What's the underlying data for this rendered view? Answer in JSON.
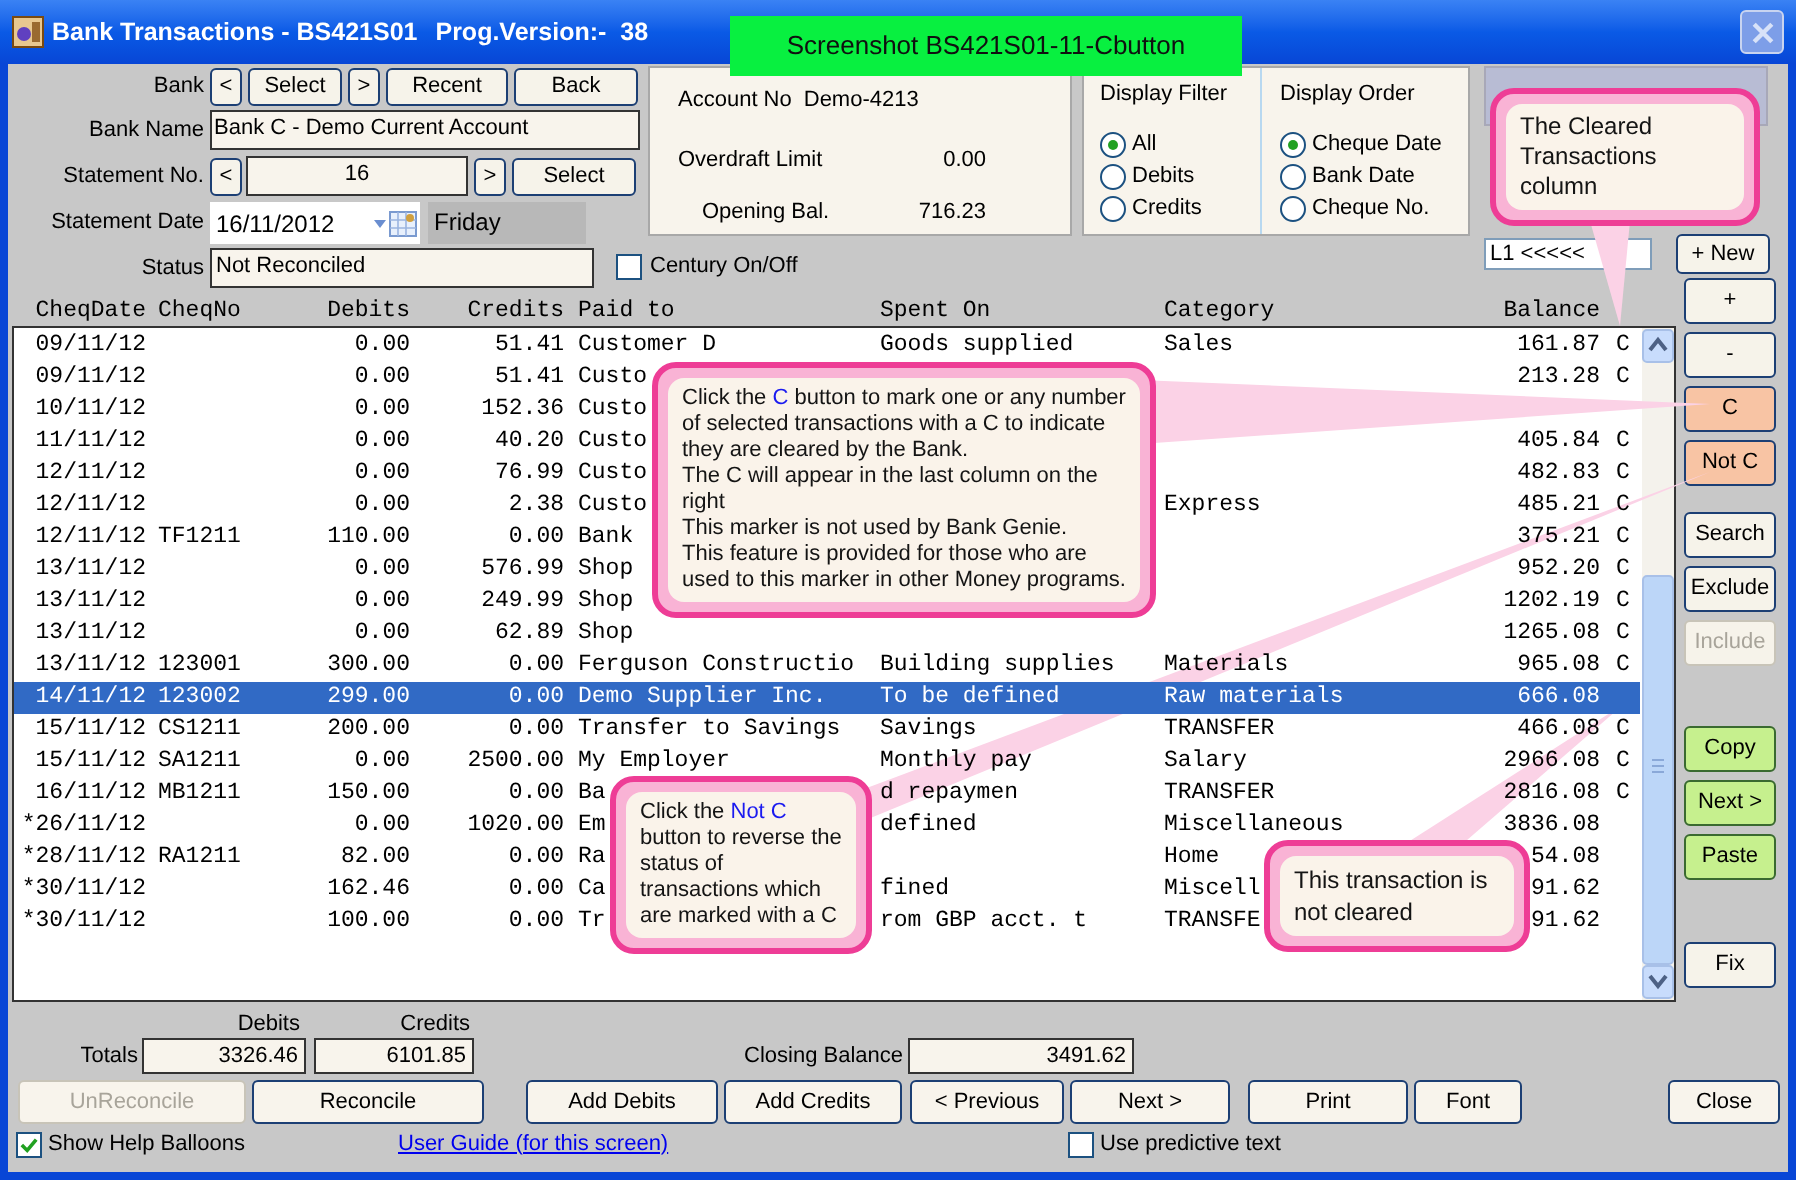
{
  "window": {
    "title": "Bank Transactions - BS421S01",
    "version": "Prog.Version:-  38"
  },
  "banner": "Screenshot BS421S01-11-Cbutton",
  "form": {
    "bank_label": "Bank",
    "bank_buttons": [
      "<",
      "Select",
      ">",
      "Recent",
      "Back"
    ],
    "bank_name_label": "Bank Name",
    "bank_name": "Bank C - Demo Current Account",
    "statement_no_label": "Statement No.",
    "statement_prev": "<",
    "statement_no": "16",
    "statement_next": ">",
    "statement_select": "Select",
    "statement_date_label": "Statement Date",
    "statement_date": "16/11/2012",
    "weekday": "Friday",
    "status_label": "Status",
    "status": "Not Reconciled",
    "century": {
      "label": "Century On/Off",
      "checked": false
    }
  },
  "account": {
    "account_no_label": "Account No",
    "account_no": "Demo-4213",
    "overdraft_label": "Overdraft Limit",
    "overdraft": "0.00",
    "opening_label": "Opening Bal.",
    "opening": "716.23"
  },
  "display_filter": {
    "title": "Display Filter",
    "options": [
      {
        "label": "All",
        "selected": true
      },
      {
        "label": "Debits",
        "selected": false
      },
      {
        "label": "Credits",
        "selected": false
      }
    ]
  },
  "display_order": {
    "title": "Display Order",
    "options": [
      {
        "label": "Cheque Date",
        "selected": true
      },
      {
        "label": "Bank Date",
        "selected": false
      },
      {
        "label": "Cheque No.",
        "selected": false
      }
    ]
  },
  "find_field": "L1 <<<<<",
  "new_button": "+ New",
  "table": {
    "columns": [
      "CheqDate",
      "CheqNo",
      "Debits",
      "Credits",
      "Paid to",
      "Spent On",
      "Category",
      "Balance"
    ],
    "rows": [
      {
        "date": "09/11/12",
        "debit": "0.00",
        "credit": "51.41",
        "paid_to": "Customer D",
        "spent_on": "Goods supplied",
        "category": "Sales",
        "balance": "161.87",
        "mark": "C",
        "selected": false
      },
      {
        "date": "09/11/12",
        "debit": "0.00",
        "credit": "51.41",
        "paid_to": "Custo",
        "balance": "213.28",
        "mark": "C",
        "selected": false
      },
      {
        "date": "10/11/12",
        "debit": "0.00",
        "credit": "152.36",
        "paid_to": "Custo",
        "selected": false
      },
      {
        "date": "11/11/12",
        "debit": "0.00",
        "credit": "40.20",
        "paid_to": "Custo",
        "balance": "405.84",
        "mark": "C",
        "selected": false
      },
      {
        "date": "12/11/12",
        "debit": "0.00",
        "credit": "76.99",
        "paid_to": "Custo",
        "balance": "482.83",
        "mark": "C",
        "selected": false
      },
      {
        "date": "12/11/12",
        "debit": "0.00",
        "credit": "2.38",
        "paid_to": "Custo",
        "category": "Express",
        "balance": "485.21",
        "mark": "C",
        "selected": false
      },
      {
        "date": "12/11/12",
        "cheque": "TF1211",
        "debit": "110.00",
        "credit": "0.00",
        "paid_to": "Bank",
        "balance": "375.21",
        "mark": "C",
        "selected": false
      },
      {
        "date": "13/11/12",
        "debit": "0.00",
        "credit": "576.99",
        "paid_to": "Shop",
        "balance": "952.20",
        "mark": "C",
        "selected": false
      },
      {
        "date": "13/11/12",
        "debit": "0.00",
        "credit": "249.99",
        "paid_to": "Shop",
        "balance": "1202.19",
        "mark": "C",
        "selected": false
      },
      {
        "date": "13/11/12",
        "debit": "0.00",
        "credit": "62.89",
        "paid_to": "Shop",
        "balance": "1265.08",
        "mark": "C",
        "selected": false
      },
      {
        "date": "13/11/12",
        "cheque": "123001",
        "debit": "300.00",
        "credit": "0.00",
        "paid_to": "Ferguson Constructio",
        "spent_on": "Building supplies",
        "category": "Materials",
        "balance": "965.08",
        "mark": "C",
        "selected": false
      },
      {
        "date": "14/11/12",
        "cheque": "123002",
        "debit": "299.00",
        "credit": "0.00",
        "paid_to": "Demo Supplier Inc.",
        "spent_on": "To be defined",
        "category": "Raw materials",
        "balance": "666.08",
        "selected": true
      },
      {
        "date": "15/11/12",
        "cheque": "CS1211",
        "debit": "200.00",
        "credit": "0.00",
        "paid_to": "Transfer to Savings",
        "spent_on": "Savings",
        "category": "TRANSFER",
        "balance": "466.08",
        "mark": "C",
        "selected": false
      },
      {
        "date": "15/11/12",
        "cheque": "SA1211",
        "debit": "0.00",
        "credit": "2500.00",
        "paid_to": "My Employer",
        "spent_on": "Monthly pay",
        "category": "Salary",
        "balance": "2966.08",
        "mark": "C",
        "selected": false
      },
      {
        "date": "16/11/12",
        "cheque": "MB1211",
        "debit": "150.00",
        "credit": "0.00",
        "paid_to": "Ba",
        "spent_on": "d repaymen",
        "category": "TRANSFER",
        "balance": "2816.08",
        "mark": "C",
        "selected": false
      },
      {
        "date": "*26/11/12",
        "debit": "0.00",
        "credit": "1020.00",
        "paid_to": "Em",
        "spent_on": "defined",
        "category": "Miscellaneous",
        "balance": "3836.08",
        "selected": false
      },
      {
        "date": "*28/11/12",
        "cheque": "RA1211",
        "debit": "82.00",
        "credit": "0.00",
        "paid_to": "Ra",
        "category": "Home",
        "balance": "54.08",
        "selected": false
      },
      {
        "date": "*30/11/12",
        "debit": "162.46",
        "credit": "0.00",
        "paid_to": "Ca",
        "spent_on": "fined",
        "category": "Miscell",
        "balance": "91.62",
        "selected": false
      },
      {
        "date": "*30/11/12",
        "debit": "100.00",
        "credit": "0.00",
        "paid_to": "Tr",
        "spent_on": "rom GBP acct. t",
        "category": "TRANSFE",
        "balance": "91.62",
        "selected": false
      }
    ]
  },
  "side_buttons": [
    [
      {
        "label": "+",
        "kind": "plain",
        "disabled": false
      },
      {
        "label": "-",
        "kind": "plain",
        "disabled": false
      },
      {
        "label": "C",
        "kind": "orange",
        "disabled": false
      },
      {
        "label": "Not C",
        "kind": "orange",
        "disabled": false
      }
    ],
    [
      {
        "label": "Search",
        "kind": "plain",
        "disabled": false
      },
      {
        "label": "Exclude",
        "kind": "plain",
        "disabled": false
      },
      {
        "label": "Include",
        "kind": "plain",
        "disabled": true
      }
    ],
    [
      {
        "label": "Copy",
        "kind": "green",
        "disabled": false
      },
      {
        "label": "Next >",
        "kind": "green",
        "disabled": false
      },
      {
        "label": "Paste",
        "kind": "green",
        "disabled": false
      }
    ],
    [
      {
        "label": "Fix",
        "kind": "plain",
        "disabled": false
      }
    ]
  ],
  "totals": {
    "debits_label": "Debits",
    "credits_label": "Credits",
    "totals_label": "Totals",
    "debits": "3326.46",
    "credits": "6101.85",
    "closing_label": "Closing Balance",
    "closing": "3491.62"
  },
  "bottom_buttons": [
    [
      {
        "label": "UnReconcile",
        "disabled": true
      },
      {
        "label": "Reconcile",
        "disabled": false
      }
    ],
    [
      {
        "label": "Add Debits",
        "disabled": false
      },
      {
        "label": "Add Credits",
        "disabled": false
      }
    ],
    [
      {
        "label": "< Previous",
        "disabled": false
      },
      {
        "label": "Next >",
        "disabled": false
      }
    ],
    [
      {
        "label": "Print",
        "disabled": false
      },
      {
        "label": "Font",
        "disabled": false
      }
    ],
    [
      {
        "label": "Close",
        "disabled": false
      }
    ]
  ],
  "footer": {
    "help_balloons": {
      "label": "Show Help Balloons",
      "checked": true
    },
    "user_guide": "User Guide (for this screen)",
    "predictive": {
      "label": "Use predictive text",
      "checked": false
    }
  },
  "balloons": [
    {
      "paragraphs": [
        [
          {
            "text": "The Cleared Transactions column",
            "highlight": false
          }
        ]
      ]
    },
    {
      "paragraphs": [
        [
          {
            "text": "Click the ",
            "highlight": false
          },
          {
            "text": "C",
            "highlight": true
          },
          {
            "text": " button to mark one or any number of selected transactions with a C to indicate they are cleared by the Bank.",
            "highlight": false
          }
        ],
        [
          {
            "text": "The C will appear in the last column on the right",
            "highlight": false
          }
        ],
        [
          {
            "text": "This marker is not used by Bank Genie.",
            "highlight": false
          }
        ],
        [
          {
            "text": "This feature is provided for those who are used to this marker in other Money programs.",
            "highlight": false
          }
        ]
      ]
    },
    {
      "paragraphs": [
        [
          {
            "text": "Click the ",
            "highlight": false
          },
          {
            "text": "Not C",
            "highlight": true
          },
          {
            "text": " button to reverse the status of transactions which are marked with a C",
            "highlight": false
          }
        ]
      ]
    },
    {
      "paragraphs": [
        [
          {
            "text": "This transaction is not cleared",
            "highlight": false
          }
        ]
      ]
    }
  ]
}
